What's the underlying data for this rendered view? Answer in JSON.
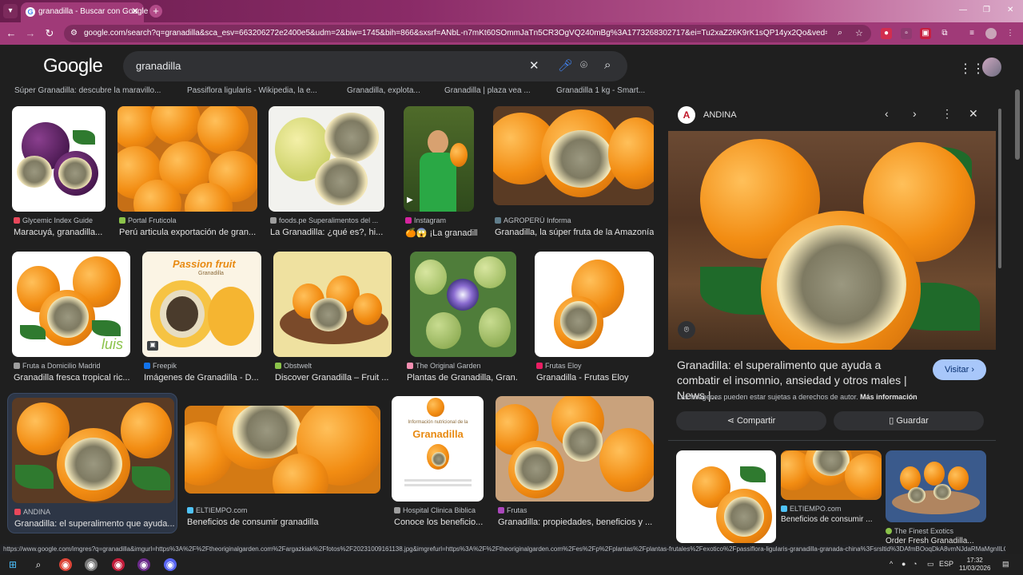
{
  "browser": {
    "tab_title": "granadilla - Buscar con Google",
    "url_host": "google.com",
    "url_rest": "/search?q=granadilla&sca_esv=663206272e2400e5&udm=2&biw=1745&bih=866&sxsrf=ANbL-n7mKt60SOmmJaTn5CR3OgVQ240mBg%3A1773268302717&ei=Tu2xaZ26K9rK1sQP14yx2Qo&ved=0ahUKEwidmZm..."
  },
  "google": {
    "logo": "Google",
    "query": "granadilla"
  },
  "prev_row": [
    "Súper Granadilla: descubre la maravillo...",
    "Passiflora ligularis - Wikipedia, la e...",
    "Granadilla, explota...",
    "Granadilla | plaza vea ...",
    "Granadilla 1 kg - Smart..."
  ],
  "rows": [
    [
      {
        "source": "Glycemic Index Guide",
        "caption": "Maracuyá, granadilla...",
        "fav": "#e8475a"
      },
      {
        "source": "Portal Fruticola",
        "caption": "Perú articula exportación de gran...",
        "fav": "#8bc34a"
      },
      {
        "source": "foods.pe Superalimentos del ...",
        "caption": "La Granadilla: ¿qué es?, hi...",
        "fav": "#9e9e9e"
      },
      {
        "source": "Instagram",
        "caption": "🍊😱 ¡La granadill...",
        "fav": "#d6249f"
      },
      {
        "source": "AGROPERÚ Informa",
        "caption": "Granadilla, la súper fruta de la Amazonía",
        "fav": "#607d8b"
      }
    ],
    [
      {
        "source": "Fruta a Domicilio Madrid",
        "caption": "Granadilla fresca tropical ric...",
        "fav": "#9e9e9e"
      },
      {
        "source": "Freepik",
        "caption": "Imágenes de Granadilla - D...",
        "fav": "#1273eb"
      },
      {
        "source": "Obstwelt",
        "caption": "Discover Granadilla – Fruit ...",
        "fav": "#8bc34a"
      },
      {
        "source": "The Original Garden",
        "caption": "Plantas de Granadilla, Gran...",
        "fav": "#f48fb1"
      },
      {
        "source": "Frutas Eloy",
        "caption": "Granadilla - Frutas Eloy",
        "fav": "#e91e63"
      }
    ],
    [
      {
        "source": "ANDINA",
        "caption": "Granadilla: el superalimento que ayuda...",
        "fav": "#e8475a"
      },
      {
        "source": "ELTIEMPO.com",
        "caption": "Beneficios de consumir granadilla",
        "fav": "#4fc3f7"
      },
      {
        "source": "Hospital Clinica Biblica",
        "caption": "Conoce los beneficio...",
        "fav": "#9e9e9e"
      },
      {
        "source": "Frutas",
        "caption": "Granadilla: propiedades, beneficios y ...",
        "fav": "#ab47bc"
      }
    ]
  ],
  "thumb_text": {
    "passion_title": "Passion fruit",
    "passion_sub": "Granadilla",
    "luis": "luis",
    "info_title": "Información nutricional de la",
    "info_name": "Granadilla"
  },
  "panel": {
    "source": "ANDINA",
    "title": "Granadilla: el superalimento que ayuda a combatir el insomnio, ansiedad y otros males | News |...",
    "visit": "Visitar",
    "note": "Las imágenes pueden estar sujetas a derechos de autor.",
    "note_link": "Más información",
    "share": "Compartir",
    "save": "Guardar",
    "related": [
      {
        "source": "",
        "caption": ""
      },
      {
        "source": "ELTIEMPO.com",
        "caption": "Beneficios de consumir ..."
      },
      {
        "source": "The Finest Exotics",
        "caption": "Order Fresh Granadilla..."
      }
    ]
  },
  "statusbar": "https://www.google.com/imgres?q=granadilla&imgurl=https%3A%2F%2Ftheoriginalgarden.com%2Fargazkiak%2Ffotos%2F20231009161138.jpg&imgrefurl=https%3A%2F%2Ftheoriginalgarden.com%2Fes%2Fp%2Fplantas%2Fplantas-frutales%2Fexotico%2Fpassiflora-ligularis-granadilla-granada-china%3Fsrsltid%3DAfmBOoqDkA8vmNJdaRMaMgnIlLQ...",
  "taskbar": {
    "lang": "ESP",
    "time": "17:32",
    "date": "11/03/2026"
  },
  "colors": {
    "browser_accent": "#a03a78",
    "page_bg": "#1f1f1f",
    "visit_button": "#a8c7fa"
  }
}
